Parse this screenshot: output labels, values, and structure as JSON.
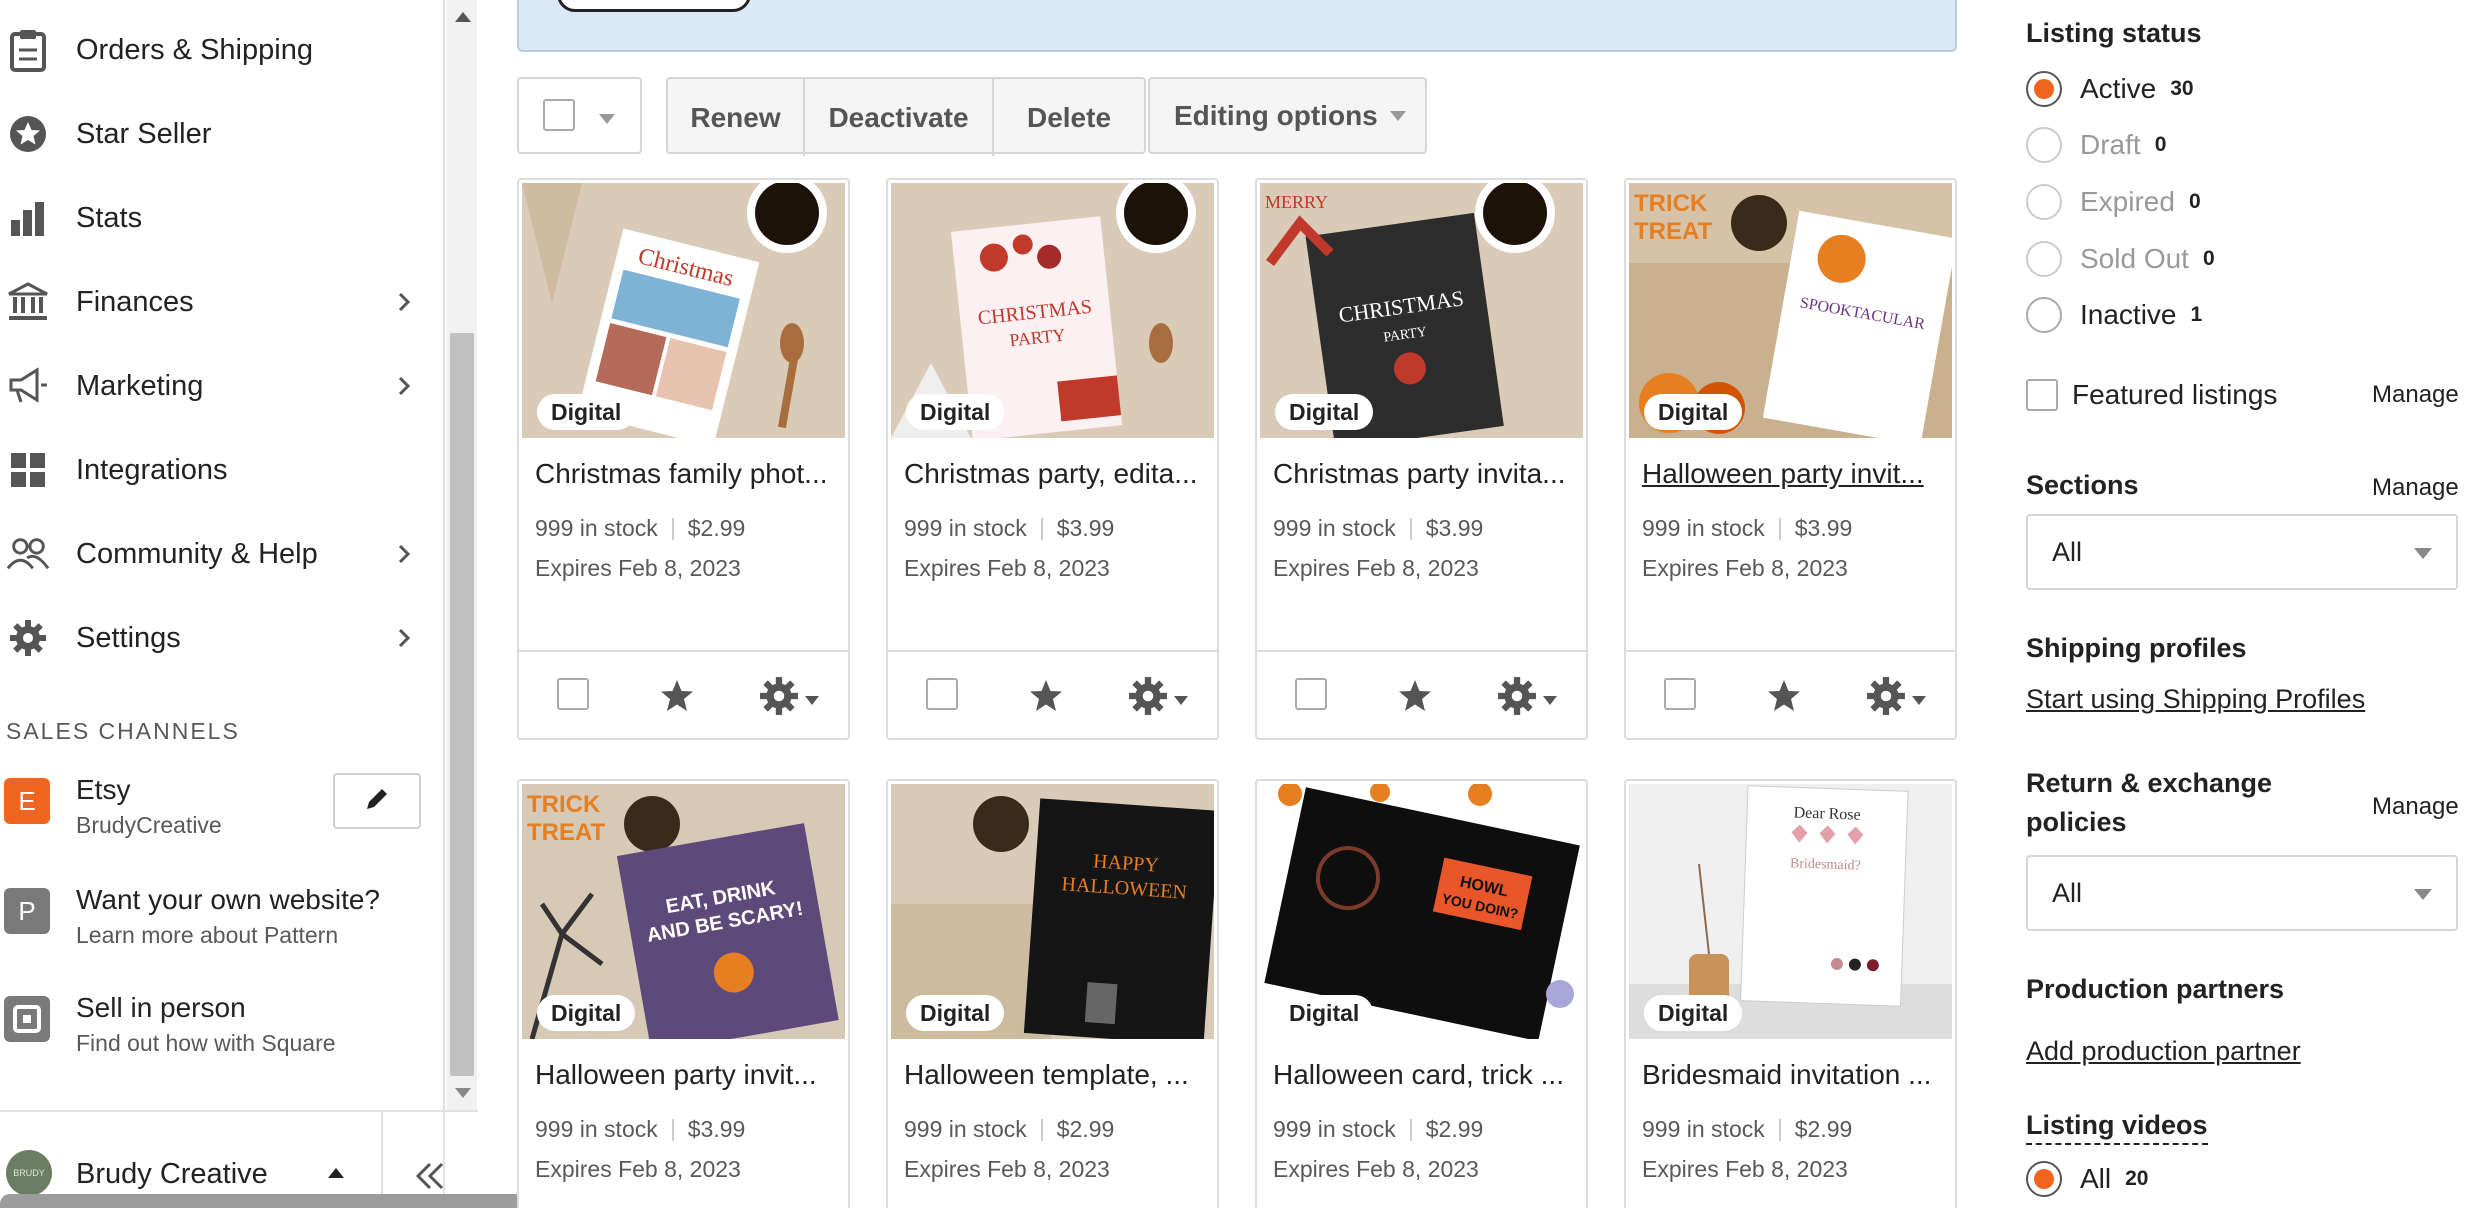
{
  "sidebar": {
    "nav": [
      {
        "label": "Orders & Shipping",
        "icon": "clipboard-icon",
        "has_chevron": false
      },
      {
        "label": "Star Seller",
        "icon": "star-badge-icon",
        "has_chevron": false
      },
      {
        "label": "Stats",
        "icon": "bar-chart-icon",
        "has_chevron": false
      },
      {
        "label": "Finances",
        "icon": "bank-icon",
        "has_chevron": true
      },
      {
        "label": "Marketing",
        "icon": "megaphone-icon",
        "has_chevron": true
      },
      {
        "label": "Integrations",
        "icon": "grid-icon",
        "has_chevron": false
      },
      {
        "label": "Community & Help",
        "icon": "people-icon",
        "has_chevron": true
      },
      {
        "label": "Settings",
        "icon": "gear-icon",
        "has_chevron": true
      }
    ],
    "sales_channels_title": "SALES CHANNELS",
    "channels": [
      {
        "badge": "E",
        "title": "Etsy",
        "sub": "BrudyCreative",
        "color": "#f1641e"
      },
      {
        "badge": "P",
        "title": "Want your own website?",
        "sub": "Learn more about Pattern",
        "color": "#7a7a7a"
      },
      {
        "badge": "",
        "title": "Sell in person",
        "sub": "Find out how with Square",
        "color": "#7a7a7a"
      }
    ],
    "account_name": "Brudy Creative",
    "avatar_text": "BRUDY"
  },
  "toolbar": {
    "renew": "Renew",
    "deactivate": "Deactivate",
    "delete": "Delete",
    "editing_options": "Editing options"
  },
  "listings": [
    {
      "title": "Christmas family phot...",
      "stock": "999 in stock",
      "price": "$2.99",
      "expires": "Expires Feb 8, 2023",
      "badge": "Digital",
      "underline": false
    },
    {
      "title": "Christmas party, edita...",
      "stock": "999 in stock",
      "price": "$3.99",
      "expires": "Expires Feb 8, 2023",
      "badge": "Digital",
      "underline": false
    },
    {
      "title": "Christmas party invita...",
      "stock": "999 in stock",
      "price": "$3.99",
      "expires": "Expires Feb 8, 2023",
      "badge": "Digital",
      "underline": false
    },
    {
      "title": "Halloween party invit...",
      "stock": "999 in stock",
      "price": "$3.99",
      "expires": "Expires Feb 8, 2023",
      "badge": "Digital",
      "underline": true
    },
    {
      "title": "Halloween party invit...",
      "stock": "999 in stock",
      "price": "$3.99",
      "expires": "Expires Feb 8, 2023",
      "badge": "Digital",
      "underline": false
    },
    {
      "title": "Halloween template, ...",
      "stock": "999 in stock",
      "price": "$2.99",
      "expires": "Expires Feb 8, 2023",
      "badge": "Digital",
      "underline": false
    },
    {
      "title": "Halloween card, trick ...",
      "stock": "999 in stock",
      "price": "$2.99",
      "expires": "Expires Feb 8, 2023",
      "badge": "Digital",
      "underline": false
    },
    {
      "title": "Bridesmaid invitation ...",
      "stock": "999 in stock",
      "price": "$2.99",
      "expires": "Expires Feb 8, 2023",
      "badge": "Digital",
      "underline": false
    }
  ],
  "filters": {
    "listing_status_title": "Listing status",
    "statuses": [
      {
        "label": "Active",
        "count": "30",
        "selected": true,
        "dim": false
      },
      {
        "label": "Draft",
        "count": "0",
        "selected": false,
        "dim": true
      },
      {
        "label": "Expired",
        "count": "0",
        "selected": false,
        "dim": true
      },
      {
        "label": "Sold Out",
        "count": "0",
        "selected": false,
        "dim": true
      },
      {
        "label": "Inactive",
        "count": "1",
        "selected": false,
        "dim": false
      }
    ],
    "featured_label": "Featured listings",
    "manage": "Manage",
    "sections_title": "Sections",
    "sections_value": "All",
    "shipping_title": "Shipping profiles",
    "shipping_link": "Start using Shipping Profiles",
    "return_title_1": "Return & exchange",
    "return_title_2": "policies",
    "return_value": "All",
    "production_title": "Production partners",
    "production_link": "Add production partner",
    "videos_title": "Listing videos",
    "videos_all": "All",
    "videos_count": "20"
  },
  "colors": {
    "accent": "#f1641e",
    "banner": "#dbe9f7"
  }
}
